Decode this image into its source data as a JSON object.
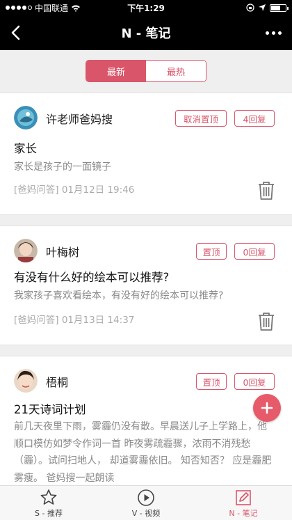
{
  "status": {
    "carrier": "中国联通",
    "time": "下午1:29",
    "battery_level": 0.7
  },
  "nav": {
    "title": "N - 笔记"
  },
  "segments": [
    {
      "label": "最新"
    },
    {
      "label": "最热"
    }
  ],
  "accent": "#d9566a",
  "posts": [
    {
      "author": "许老师爸妈搜",
      "pin_label": "取消置顶",
      "reply_label": "4回复",
      "title": "家长",
      "body": "家长是孩子的一面镜子",
      "meta": "[爸妈问答] 01月12日 19:46"
    },
    {
      "author": "叶梅树",
      "pin_label": "置顶",
      "reply_label": "0回复",
      "title": "有没有什么好的绘本可以推荐?",
      "body": "我家孩子喜欢看绘本，有没有好的绘本可以推荐?",
      "meta": "[爸妈问答] 01月13日 14:37"
    },
    {
      "author": "梧桐",
      "pin_label": "置顶",
      "reply_label": "0回复",
      "title": "21天诗词计划",
      "body": "前几天夜里下雨，雾霾仍没有散。早晨送儿子上学路上，他顺口模仿如梦令作词一首 昨夜雾疏霾骤，浓雨不消残愁（霾）。试问扫地人， 却道雾霾依旧。 知否知否？ 应是霾肥雾瘦。 爸妈搜一起朗读"
    }
  ],
  "tabs": [
    {
      "label": "S - 推荐",
      "icon": "star-icon"
    },
    {
      "label": "V - 视频",
      "icon": "play-icon"
    },
    {
      "label": "N - 笔记",
      "icon": "edit-icon"
    }
  ]
}
